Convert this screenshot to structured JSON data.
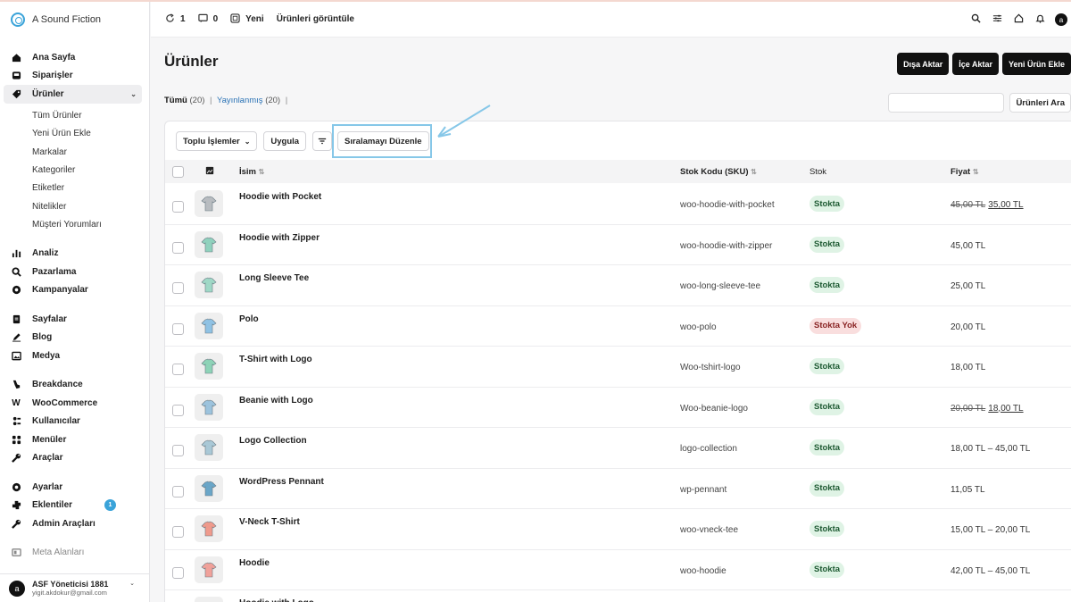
{
  "brand": {
    "name": "A Sound Fiction"
  },
  "sidebar": {
    "items": [
      {
        "label": "Ana Sayfa",
        "icon": "home-icon"
      },
      {
        "label": "Siparişler",
        "icon": "inbox-icon"
      },
      {
        "label": "Ürünler",
        "icon": "tag-icon"
      }
    ],
    "products_sub": [
      "Tüm Ürünler",
      "Yeni Ürün Ekle",
      "Markalar",
      "Kategoriler",
      "Etiketler",
      "Nitelikler",
      "Müşteri Yorumları"
    ],
    "group2": [
      {
        "label": "Analiz",
        "icon": "bar-chart-icon"
      },
      {
        "label": "Pazarlama",
        "icon": "megaphone-icon"
      },
      {
        "label": "Kampanyalar",
        "icon": "gear-badge-icon"
      }
    ],
    "group3": [
      {
        "label": "Sayfalar",
        "icon": "pages-icon"
      },
      {
        "label": "Blog",
        "icon": "pen-icon"
      },
      {
        "label": "Medya",
        "icon": "image-icon"
      }
    ],
    "group4": [
      {
        "label": "Breakdance",
        "icon": "breakdance-icon"
      },
      {
        "label": "WooCommerce",
        "icon": "woo-icon"
      },
      {
        "label": "Kullanıcılar",
        "icon": "users-icon"
      },
      {
        "label": "Menüler",
        "icon": "grid-icon"
      },
      {
        "label": "Araçlar",
        "icon": "wrench-icon"
      }
    ],
    "group5": [
      {
        "label": "Ayarlar",
        "icon": "settings-icon"
      },
      {
        "label": "Eklentiler",
        "icon": "plugin-icon",
        "badge": "1"
      },
      {
        "label": "Admin Araçları",
        "icon": "tool-icon"
      }
    ],
    "meta": {
      "label": "Meta Alanları",
      "icon": "meta-icon"
    },
    "user": {
      "avatar": "a",
      "name": "ASF Yöneticisi 1881",
      "email": "yigit.akdokur@gmail.com"
    }
  },
  "topbar": {
    "updates": "1",
    "comments": "0",
    "new_label": "Yeni",
    "view_label": "Ürünleri görüntüle",
    "avatar": "a"
  },
  "page": {
    "title": "Ürünler",
    "export_label": "Dışa Aktar",
    "import_label": "İçe Aktar",
    "add_label": "Yeni Ürün Ekle",
    "filter_all": "Tümü",
    "filter_all_count": "(20)",
    "filter_published": "Yayınlanmış",
    "filter_published_count": "(20)",
    "search_button": "Ürünleri Ara",
    "bulk_label": "Toplu İşlemler",
    "apply_label": "Uygula",
    "sort_label": "Sıralamayı Düzenle"
  },
  "table": {
    "columns": {
      "name": "İsim",
      "sku": "Stok Kodu (SKU)",
      "stock": "Stok",
      "price": "Fiyat"
    },
    "rows": [
      {
        "name": "Hoodie with Pocket",
        "sku": "woo-hoodie-with-pocket",
        "stock": "Stokta",
        "in_stock": true,
        "old_price": "45,00 TL",
        "price": "35,00 TL",
        "thumb_color": "#b8bcc0"
      },
      {
        "name": "Hoodie with Zipper",
        "sku": "woo-hoodie-with-zipper",
        "stock": "Stokta",
        "in_stock": true,
        "old_price": "",
        "price": "45,00 TL",
        "thumb_color": "#8fd1bd"
      },
      {
        "name": "Long Sleeve Tee",
        "sku": "woo-long-sleeve-tee",
        "stock": "Stokta",
        "in_stock": true,
        "old_price": "",
        "price": "25,00 TL",
        "thumb_color": "#9fd8c6"
      },
      {
        "name": "Polo",
        "sku": "woo-polo",
        "stock": "Stokta Yok",
        "in_stock": false,
        "old_price": "",
        "price": "20,00 TL",
        "thumb_color": "#8fc2e4"
      },
      {
        "name": "T-Shirt with Logo",
        "sku": "Woo-tshirt-logo",
        "stock": "Stokta",
        "in_stock": true,
        "old_price": "",
        "price": "18,00 TL",
        "thumb_color": "#8dd3b7"
      },
      {
        "name": "Beanie with Logo",
        "sku": "Woo-beanie-logo",
        "stock": "Stokta",
        "in_stock": true,
        "old_price": "20,00 TL",
        "price": "18,00 TL",
        "thumb_color": "#9cc3dd"
      },
      {
        "name": "Logo Collection",
        "sku": "logo-collection",
        "stock": "Stokta",
        "in_stock": true,
        "old_price": "",
        "price": "18,00 TL – 45,00 TL",
        "thumb_color": "#a9c8d6"
      },
      {
        "name": "WordPress Pennant",
        "sku": "wp-pennant",
        "stock": "Stokta",
        "in_stock": true,
        "old_price": "",
        "price": "11,05 TL",
        "thumb_color": "#6aa6c8"
      },
      {
        "name": "V-Neck T-Shirt",
        "sku": "woo-vneck-tee",
        "stock": "Stokta",
        "in_stock": true,
        "old_price": "",
        "price": "15,00 TL – 20,00 TL",
        "thumb_color": "#ef9a8c"
      },
      {
        "name": "Hoodie",
        "sku": "woo-hoodie",
        "stock": "Stokta",
        "in_stock": true,
        "old_price": "",
        "price": "42,00 TL – 45,00 TL",
        "thumb_color": "#f0a19a"
      },
      {
        "name": "Hoodie with Logo",
        "sku": "",
        "stock": "",
        "in_stock": true,
        "old_price": "",
        "price": "",
        "thumb_color": "#a5cbe0"
      }
    ]
  },
  "colors": {
    "accent": "#3aa3d9",
    "in_stock_bg": "#dff3e5",
    "out_stock_bg": "#f9dede",
    "highlight": "#86c7e8"
  }
}
